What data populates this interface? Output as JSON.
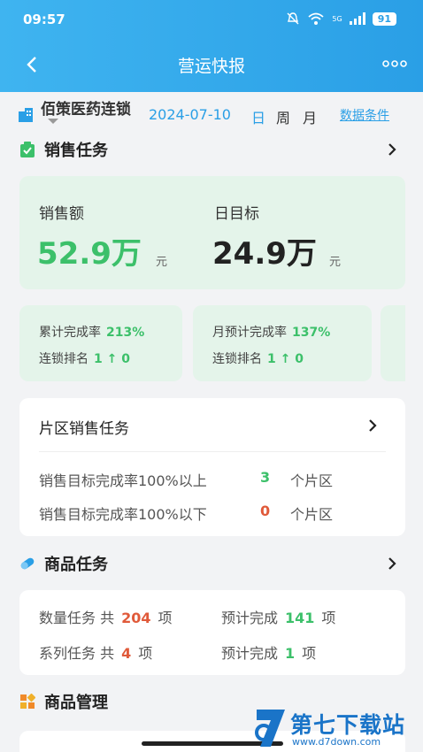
{
  "status_bar": {
    "time": "09:57",
    "network": "5G",
    "battery": "91"
  },
  "nav": {
    "title": "营运快报"
  },
  "info": {
    "org_name": "佰策医药连锁",
    "date": "2024-07-10",
    "period_day": "日",
    "period_week": "周",
    "period_month": "月",
    "data_conditions": "数据条件"
  },
  "sales_task": {
    "title": "销售任务",
    "sales_label": "销售额",
    "sales_value": "52.9万",
    "sales_unit": "元",
    "target_label": "日目标",
    "target_value": "24.9万",
    "target_unit": "元"
  },
  "mini_cards": [
    {
      "line1_label": "累计完成率",
      "line1_value": "213%",
      "line2_label": "连锁排名",
      "line2_value": "1 ↑ 0"
    },
    {
      "line1_label": "月预计完成率",
      "line1_value": "137%",
      "line2_label": "连锁排名",
      "line2_value": "1 ↑ 0"
    }
  ],
  "area_task": {
    "title": "片区销售任务",
    "row1_text": "销售目标完成率100%以上",
    "row1_value": "3",
    "row1_unit": "个片区",
    "row2_text": "销售目标完成率100%以下",
    "row2_value": "0",
    "row2_unit": "个片区"
  },
  "goods_task": {
    "title": "商品任务",
    "qty_label": "数量任务 共",
    "qty_value": "204",
    "qty_unit": "项",
    "qty_pred_label": "预计完成",
    "qty_pred_value": "141",
    "qty_pred_unit": "项",
    "series_label": "系列任务 共",
    "series_value": "4",
    "series_unit": "项",
    "series_pred_label": "预计完成",
    "series_pred_value": "1",
    "series_pred_unit": "项"
  },
  "goods_mgmt": {
    "title": "商品管理"
  },
  "watermark": {
    "text": "第七下载站",
    "url": "www.d7down.com"
  },
  "colors": {
    "header": "#2a9fe6",
    "green": "#3cc06a",
    "red": "#e05a3a",
    "card_green": "#e4f4ea"
  }
}
